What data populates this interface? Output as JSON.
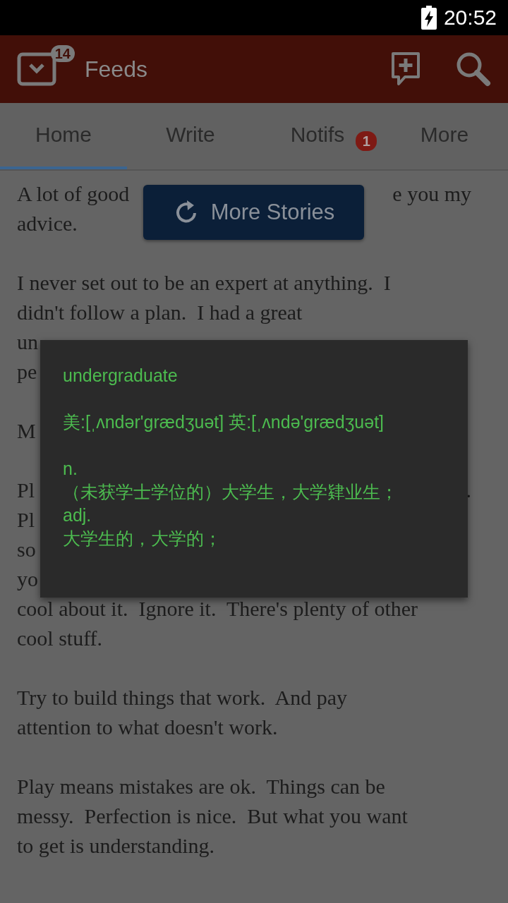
{
  "status_bar": {
    "time": "20:52"
  },
  "app_bar": {
    "title": "Feeds",
    "badge": "14"
  },
  "tabs": [
    {
      "label": "Home",
      "selected": true
    },
    {
      "label": "Write",
      "selected": false
    },
    {
      "label": "Notifs",
      "selected": false,
      "badge": "1"
    },
    {
      "label": "More",
      "selected": false
    }
  ],
  "article": {
    "paragraphs": [
      {
        "lines": [
          {
            "text": "A lot of good",
            "right": "e you my"
          },
          {
            "text": "advice."
          }
        ]
      },
      {
        "lines": [
          {
            "text": "I never set out to be an expert at anything.  I"
          },
          {
            "text": "didn't follow a plan.  I had a great"
          },
          {
            "text": "un"
          },
          {
            "text": "pe"
          }
        ]
      },
      {
        "lines": [
          {
            "text": "M"
          }
        ]
      },
      {
        "lines": [
          {
            "text": "Pl",
            "right": "."
          },
          {
            "text": "Pl"
          },
          {
            "text": "so"
          },
          {
            "text": "yo"
          },
          {
            "text": "cool about it.  Ignore it.  There's plenty of other"
          },
          {
            "text": "cool stuff."
          }
        ]
      },
      {
        "lines": [
          {
            "text": "Try to build things that work.  And pay"
          },
          {
            "text": "attention to what doesn't work."
          }
        ]
      },
      {
        "lines": [
          {
            "text": "Play means mistakes are ok.  Things can be"
          },
          {
            "text": "messy.  Perfection is nice.  But what you want"
          },
          {
            "text": "to get is understanding."
          }
        ]
      }
    ]
  },
  "more_stories_button": {
    "label": "More Stories"
  },
  "dictionary_popup": {
    "word": "undergraduate",
    "pronunciation": "美:[ˌʌndər'grædʒuət] 英:[ˌʌndə'grædʒuət]",
    "senses": [
      {
        "pos": "n.",
        "meaning": "（未获学士学位的）大学生，大学肄业生；"
      },
      {
        "pos": "adj.",
        "meaning": "大学生的，大学的；"
      }
    ]
  }
}
